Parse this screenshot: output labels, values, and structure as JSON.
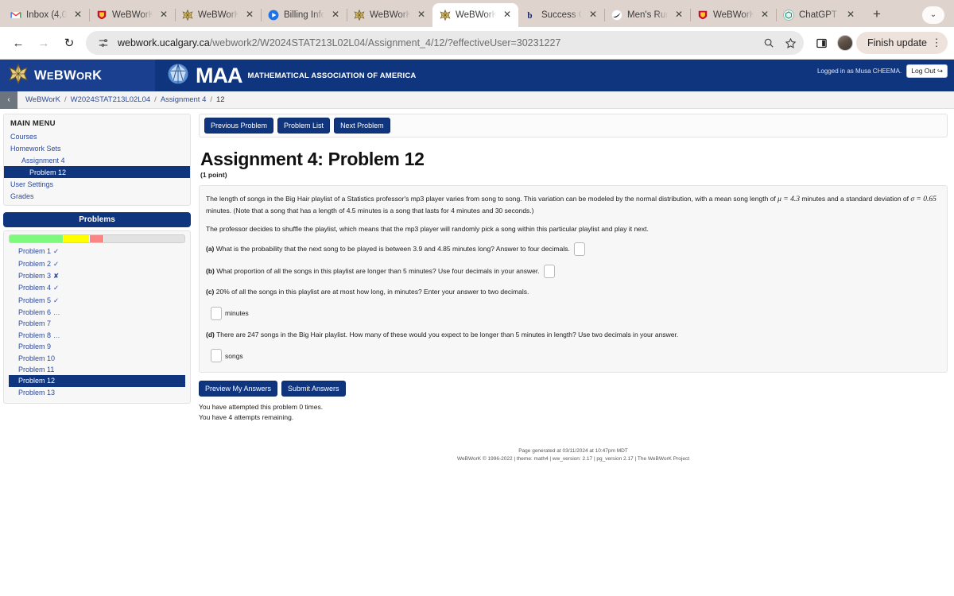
{
  "browser": {
    "tabs": [
      {
        "title": "Inbox (4,00",
        "icon": "gmail-icon",
        "active": false
      },
      {
        "title": "WeBWorK",
        "icon": "ucalgary-shield-icon",
        "active": false
      },
      {
        "title": "WeBWorK",
        "icon": "webwork-star-icon",
        "active": false
      },
      {
        "title": "Billing Info",
        "icon": "billing-circle-icon",
        "active": false
      },
      {
        "title": "WeBWorK",
        "icon": "webwork-star-icon",
        "active": false
      },
      {
        "title": "WeBWorK",
        "icon": "webwork-star-icon",
        "active": true
      },
      {
        "title": "Success C",
        "icon": "brightspace-b-icon",
        "active": false
      },
      {
        "title": "Men's Run",
        "icon": "nike-swoosh-icon",
        "active": false
      },
      {
        "title": "WeBWorK",
        "icon": "ucalgary-shield-icon",
        "active": false
      },
      {
        "title": "ChatGPT",
        "icon": "chatgpt-icon",
        "active": false
      }
    ],
    "new_tab_label": "+",
    "tab_list_chevron": "⌄",
    "back_label": "←",
    "forward_label": "→",
    "reload_label": "↻",
    "url_domain": "webwork.ucalgary.ca",
    "url_path": "/webwork2/W2024STAT213L02L04/Assignment_4/12/?effectiveUser=30231227",
    "finish_update_label": "Finish update",
    "kebab_label": "⋮"
  },
  "site": {
    "brand": "WeBWorK",
    "maa_text": "MAA",
    "maa_subtitle": "MATHEMATICAL ASSOCIATION OF AMERICA",
    "logged_in_text": "Logged in as Musa CHEEMA.",
    "logout_label": "Log Out",
    "logout_icon": "↪"
  },
  "breadcrumb": {
    "toggle_icon": "‹",
    "items": [
      "WeBWorK",
      "W2024STAT213L02L04",
      "Assignment 4",
      "12"
    ]
  },
  "sidebar": {
    "menu_title": "MAIN MENU",
    "items": [
      {
        "label": "Courses",
        "indent": 0,
        "active": false
      },
      {
        "label": "Homework Sets",
        "indent": 0,
        "active": false
      },
      {
        "label": "Assignment 4",
        "indent": 1,
        "active": false
      },
      {
        "label": "Problem 12",
        "indent": 2,
        "active": true
      },
      {
        "label": "User Settings",
        "indent": 0,
        "active": false
      },
      {
        "label": "Grades",
        "indent": 0,
        "active": false
      }
    ],
    "problems_header": "Problems",
    "progress": [
      {
        "color": "#7dfa7d",
        "width": 31
      },
      {
        "color": "#ffff00",
        "width": 15
      },
      {
        "color": "#fb8585",
        "width": 8
      },
      {
        "color": "#e2e2e2",
        "width": 46
      }
    ],
    "problems": [
      {
        "label": "Problem 1",
        "mark": "✓",
        "active": false
      },
      {
        "label": "Problem 2",
        "mark": "✓",
        "active": false
      },
      {
        "label": "Problem 3",
        "mark": "✘",
        "active": false
      },
      {
        "label": "Problem 4",
        "mark": "✓",
        "active": false
      },
      {
        "label": "Problem 5",
        "mark": "✓",
        "active": false
      },
      {
        "label": "Problem 6",
        "mark": "…",
        "active": false
      },
      {
        "label": "Problem 7",
        "mark": "",
        "active": false
      },
      {
        "label": "Problem 8",
        "mark": "…",
        "active": false
      },
      {
        "label": "Problem 9",
        "mark": "",
        "active": false
      },
      {
        "label": "Problem 10",
        "mark": "",
        "active": false
      },
      {
        "label": "Problem 11",
        "mark": "",
        "active": false
      },
      {
        "label": "Problem 12",
        "mark": "",
        "active": true
      },
      {
        "label": "Problem 13",
        "mark": "",
        "active": false
      }
    ]
  },
  "main": {
    "nav_buttons": {
      "previous": "Previous Problem",
      "list": "Problem List",
      "next": "Next Problem"
    },
    "title": "Assignment 4: Problem 12",
    "points": "(1 point)",
    "intro_1_a": "The length of songs in the Big Hair playlist of a Statistics professor's mp3 player varies from song to song. This variation can be modeled by the normal distribution, with a mean song length of ",
    "intro_1_mu": "μ = 4.3",
    "intro_1_b": " minutes and a standard deviation of ",
    "intro_1_sigma": "σ = 0.65",
    "intro_1_c": " minutes. (Note that a song that has a length of 4.5 minutes is a song that lasts for 4 minutes and 30 seconds.)",
    "intro_2": "The professor decides to shuffle the playlist, which means that the mp3 player will randomly pick a song within this particular playlist and play it next.",
    "part_a_label": "(a)",
    "part_a_text": "What is the probability that the next song to be played is between 3.9 and 4.85 minutes long? Answer to four decimals.",
    "part_b_label": "(b)",
    "part_b_text": "What proportion of all the songs in this playlist are longer than 5 minutes? Use four decimals in your answer.",
    "part_c_label": "(c)",
    "part_c_text": "20% of all the songs in this playlist are at most how long, in minutes? Enter your answer to two decimals.",
    "part_c_unit": "minutes",
    "part_d_label": "(d)",
    "part_d_text": "There are 247 songs in the Big Hair playlist. How many of these would you expect to be longer than 5 minutes in length? Use two decimals in your answer.",
    "part_d_unit": "songs",
    "answer_a_value": "",
    "answer_b_value": "",
    "answer_c_value": "",
    "answer_d_value": "",
    "preview_label": "Preview My Answers",
    "submit_label": "Submit Answers",
    "attempts_line_1": "You have attempted this problem 0 times.",
    "attempts_line_2": "You have 4 attempts remaining."
  },
  "footer": {
    "line1": "Page generated at 03/11/2024 at 10:47pm MDT",
    "line2": "WeBWorK © 1996-2022 | theme: math4 | ww_version: 2.17 | pg_version 2.17 | The WeBWorK Project"
  },
  "colors": {
    "ww_blue": "#10357f",
    "link_blue": "#2b4a9b",
    "chrome_tabbar": "#ded4cd"
  }
}
